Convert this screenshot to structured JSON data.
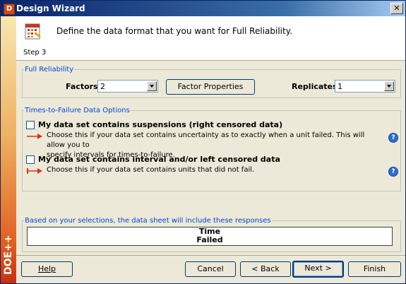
{
  "window": {
    "title": "Design Wizard",
    "app_icon_letter": "D",
    "close_glyph": "✕"
  },
  "sidebar": {
    "brand": "DOE++"
  },
  "header": {
    "description": "Define the data format that you want for Full Reliability.",
    "step_label": "Step 3",
    "icon": "calendar-grid-icon"
  },
  "full_reliability": {
    "legend": "Full Reliability",
    "factors_label": "Factors",
    "factors_value": "2",
    "factor_properties_button": "Factor Properties",
    "replicates_label": "Replicates",
    "replicates_value": "1"
  },
  "ttf_options": {
    "legend": "Times-to-Failure Data Options",
    "suspensions": {
      "label": "My data set contains suspensions (right censored data)",
      "checked": false,
      "description_line1": "Choose this if your data set contains uncertainty as to exactly when a unit failed. This will allow you to",
      "description_line2": "specify intervals for times-to-failure.",
      "arrow_icon": "right-arrow-icon",
      "help_icon": "help-icon"
    },
    "interval": {
      "label": "My data set contains interval and/or left censored data",
      "checked": false,
      "description": "Choose this if your data set contains units that did not fail.",
      "arrow_icon": "interval-arrow-icon",
      "help_icon": "help-icon"
    }
  },
  "responses": {
    "legend": "Based on your selections, the data sheet will include these responses",
    "lines": [
      "Time",
      "Failed"
    ]
  },
  "buttons": {
    "help": "Help",
    "cancel": "Cancel",
    "back": "< Back",
    "next": "Next >",
    "finish": "Finish"
  },
  "colors": {
    "legend_text": "#0046d5",
    "arrow_red": "#e0301e",
    "title_bar": "#0a246a"
  }
}
